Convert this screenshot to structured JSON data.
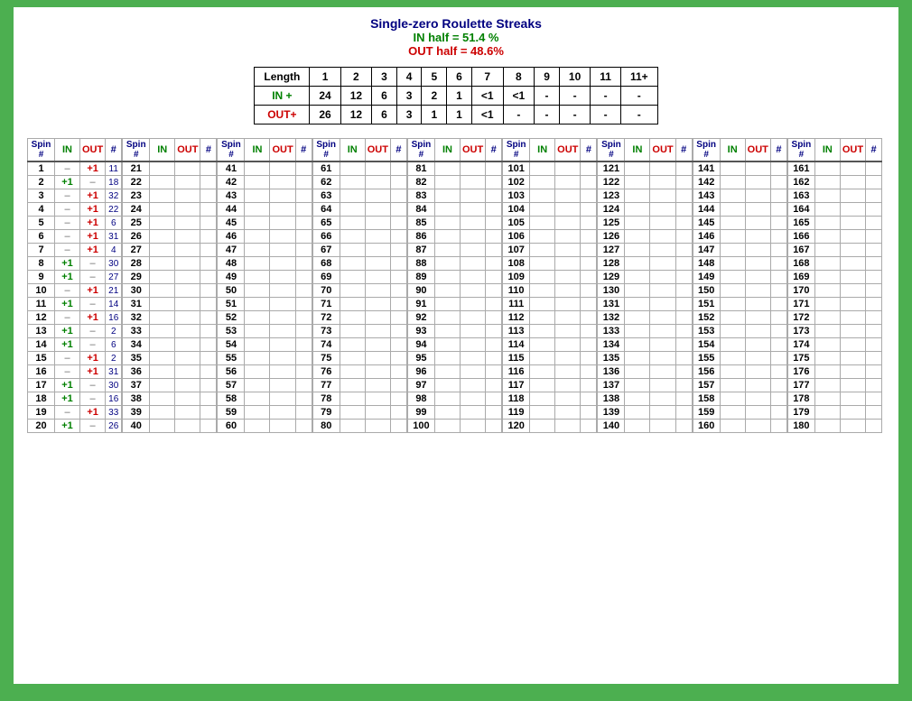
{
  "header": {
    "title": "Single-zero Roulette Streaks",
    "in_half": "IN half = 51.4 %",
    "out_half": "OUT half = 48.6%"
  },
  "summary": {
    "columns": [
      "Length",
      "1",
      "2",
      "3",
      "4",
      "5",
      "6",
      "7",
      "8",
      "9",
      "10",
      "11",
      "11+"
    ],
    "in_row": [
      "IN +",
      "24",
      "12",
      "6",
      "3",
      "2",
      "1",
      "<1",
      "<1",
      "-",
      "-",
      "-",
      "-"
    ],
    "out_row": [
      "OUT+",
      "26",
      "12",
      "6",
      "3",
      "1",
      "1",
      "<1",
      "-",
      "-",
      "-",
      "-",
      "-"
    ]
  },
  "spin_table_headers": [
    "Spin #",
    "IN",
    "OUT",
    "#"
  ],
  "spins": [
    {
      "spin": 1,
      "in": "–",
      "out": "+1",
      "hash": "11"
    },
    {
      "spin": 2,
      "in": "+1",
      "out": "–",
      "hash": "18"
    },
    {
      "spin": 3,
      "in": "–",
      "out": "+1",
      "hash": "32"
    },
    {
      "spin": 4,
      "in": "–",
      "out": "+1",
      "hash": "22"
    },
    {
      "spin": 5,
      "in": "–",
      "out": "+1",
      "hash": "6"
    },
    {
      "spin": 6,
      "in": "–",
      "out": "+1",
      "hash": "31"
    },
    {
      "spin": 7,
      "in": "–",
      "out": "+1",
      "hash": "4"
    },
    {
      "spin": 8,
      "in": "+1",
      "out": "–",
      "hash": "30"
    },
    {
      "spin": 9,
      "in": "+1",
      "out": "–",
      "hash": "27"
    },
    {
      "spin": 10,
      "in": "–",
      "out": "+1",
      "hash": "21"
    },
    {
      "spin": 11,
      "in": "+1",
      "out": "–",
      "hash": "14"
    },
    {
      "spin": 12,
      "in": "–",
      "out": "+1",
      "hash": "16"
    },
    {
      "spin": 13,
      "in": "+1",
      "out": "–",
      "hash": "2"
    },
    {
      "spin": 14,
      "in": "+1",
      "out": "–",
      "hash": "6"
    },
    {
      "spin": 15,
      "in": "–",
      "out": "+1",
      "hash": "2"
    },
    {
      "spin": 16,
      "in": "–",
      "out": "+1",
      "hash": "31"
    },
    {
      "spin": 17,
      "in": "+1",
      "out": "–",
      "hash": "30"
    },
    {
      "spin": 18,
      "in": "+1",
      "out": "–",
      "hash": "16"
    },
    {
      "spin": 19,
      "in": "–",
      "out": "+1",
      "hash": "33"
    },
    {
      "spin": 20,
      "in": "+1",
      "out": "–",
      "hash": "26"
    },
    {
      "spin": 41,
      "in": "",
      "out": "",
      "hash": ""
    },
    {
      "spin": 42,
      "in": "",
      "out": "",
      "hash": ""
    },
    {
      "spin": 43,
      "in": "",
      "out": "",
      "hash": ""
    },
    {
      "spin": 44,
      "in": "",
      "out": "",
      "hash": ""
    },
    {
      "spin": 45,
      "in": "",
      "out": "",
      "hash": ""
    },
    {
      "spin": 46,
      "in": "",
      "out": "",
      "hash": ""
    },
    {
      "spin": 47,
      "in": "",
      "out": "",
      "hash": ""
    },
    {
      "spin": 48,
      "in": "",
      "out": "",
      "hash": ""
    },
    {
      "spin": 49,
      "in": "",
      "out": "",
      "hash": ""
    },
    {
      "spin": 50,
      "in": "",
      "out": "",
      "hash": ""
    },
    {
      "spin": 51,
      "in": "",
      "out": "",
      "hash": ""
    },
    {
      "spin": 52,
      "in": "",
      "out": "",
      "hash": ""
    },
    {
      "spin": 53,
      "in": "",
      "out": "",
      "hash": ""
    },
    {
      "spin": 54,
      "in": "",
      "out": "",
      "hash": ""
    },
    {
      "spin": 55,
      "in": "",
      "out": "",
      "hash": ""
    },
    {
      "spin": 56,
      "in": "",
      "out": "",
      "hash": ""
    },
    {
      "spin": 57,
      "in": "",
      "out": "",
      "hash": ""
    },
    {
      "spin": 58,
      "in": "",
      "out": "",
      "hash": ""
    },
    {
      "spin": 59,
      "in": "",
      "out": "",
      "hash": ""
    },
    {
      "spin": 60,
      "in": "",
      "out": "",
      "hash": ""
    }
  ]
}
